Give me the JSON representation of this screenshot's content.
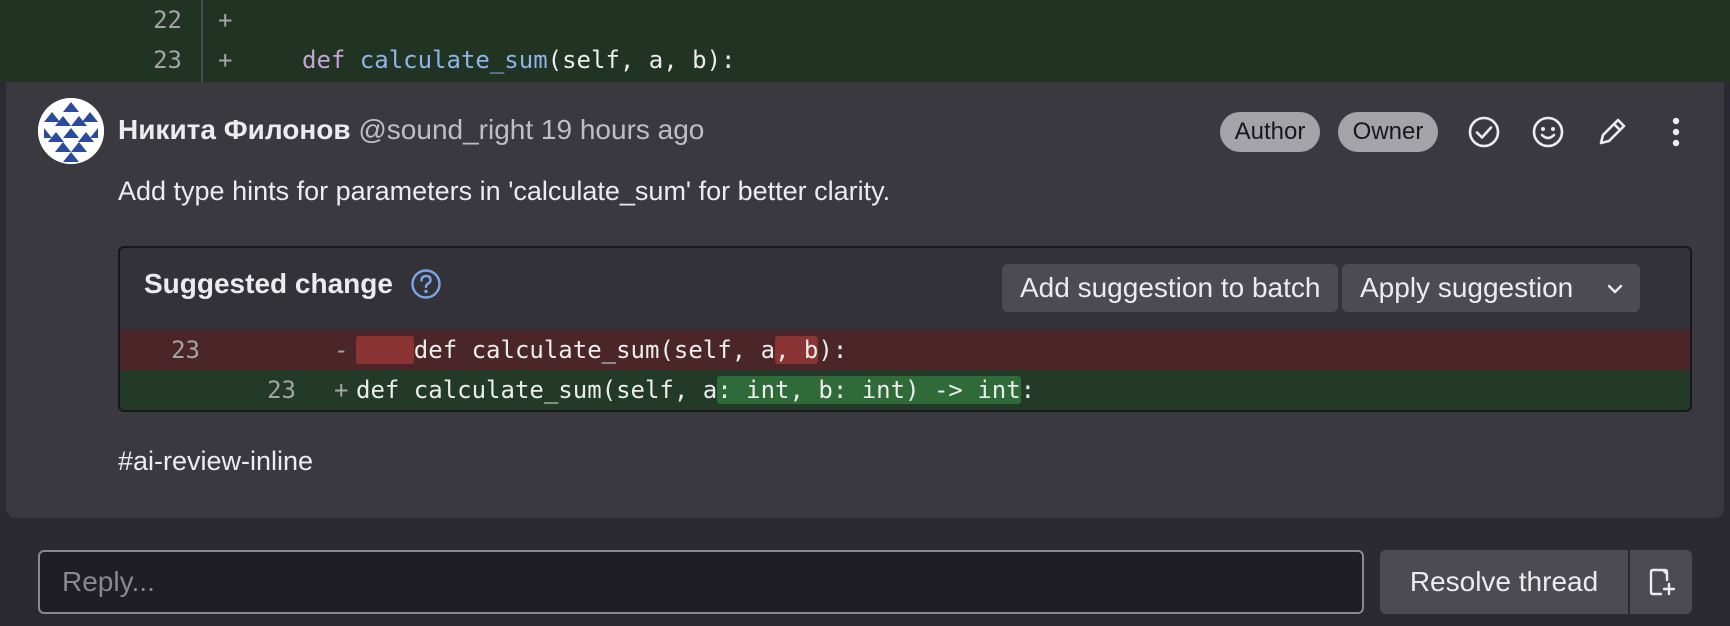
{
  "diff_context": {
    "rows": [
      {
        "line": "22",
        "sign": "+",
        "keyword": "",
        "func": "",
        "rest": ""
      },
      {
        "line": "23",
        "sign": "+",
        "keyword": "def ",
        "func": "calculate_sum",
        "rest": "(self, a, b):"
      }
    ]
  },
  "note": {
    "author_name": "Никита Филонов",
    "author_handle": "@sound_right",
    "time": "19 hours ago",
    "badges": [
      "Author",
      "Owner"
    ],
    "actions": [
      "resolve-check-icon",
      "emoji-icon",
      "pencil-icon",
      "more-vertical-icon"
    ],
    "body": "Add type hints for parameters in 'calculate_sum' for better clarity.",
    "tag": "#ai-review-inline"
  },
  "suggestion": {
    "title": "Suggested change",
    "add_to_batch": "Add suggestion to batch",
    "apply": "Apply suggestion",
    "old_row": {
      "line": "23",
      "sign": "-",
      "code_a": "def calculate_sum(self, a",
      "code_del": ", b",
      "code_b": "):"
    },
    "new_row": {
      "line": "23",
      "sign": "+",
      "code_a": "def calculate_sum(self, a",
      "code_add": ": int, b: int) -> int",
      "code_b": ":"
    }
  },
  "reply": {
    "placeholder": "Reply...",
    "resolve_label": "Resolve thread"
  },
  "colors": {
    "added_line_bg": "#213424",
    "removed_line_bg": "#4b2628",
    "card_bg": "#3a393f",
    "badge_bg": "#a4a3a8"
  }
}
